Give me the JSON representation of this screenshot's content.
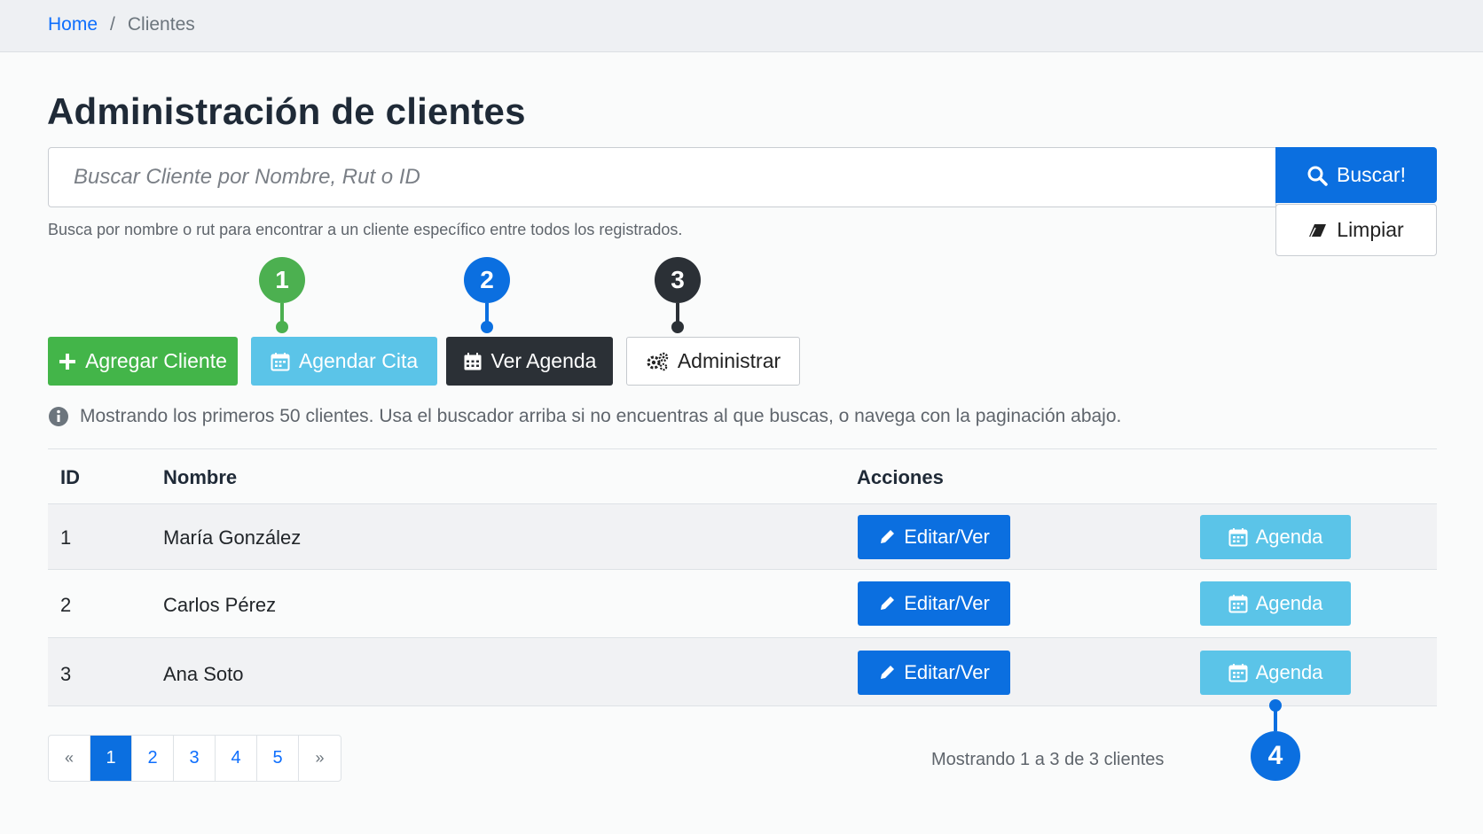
{
  "breadcrumb": {
    "home": "Home",
    "separator": "/",
    "current": "Clientes"
  },
  "page": {
    "title": "Administración de clientes"
  },
  "search": {
    "placeholder": "Buscar Cliente por Nombre, Rut o ID",
    "value": "",
    "submit_label": "Buscar!",
    "clear_label": "Limpiar",
    "help": "Busca por nombre o rut para encontrar a un cliente específico entre todos los registrados."
  },
  "actions": {
    "add_client": "Agregar Cliente",
    "schedule": "Agendar Cita",
    "view_agenda": "Ver Agenda",
    "admin": "Administrar"
  },
  "markers": [
    {
      "label": "1",
      "color": "#4cb050"
    },
    {
      "label": "2",
      "color": "#0b6fe0"
    },
    {
      "label": "3",
      "color": "#2b3036"
    },
    {
      "label": "4",
      "color": "#0b6fe0"
    }
  ],
  "info": "Mostrando los primeros 50 clientes. Usa el buscador arriba si no encuentras al que buscas,  o navega con la paginación abajo.",
  "table": {
    "headers": {
      "id": "ID",
      "name": "Nombre",
      "actions": "Acciones"
    },
    "rows": [
      {
        "id": "1",
        "name": "María González",
        "edit": "Editar/Ver",
        "agenda": "Agenda"
      },
      {
        "id": "2",
        "name": "Carlos Pérez",
        "edit": "Editar/Ver",
        "agenda": "Agenda"
      },
      {
        "id": "3",
        "name": "Ana Soto",
        "edit": "Editar/Ver",
        "agenda": "Agenda"
      }
    ]
  },
  "pagination": {
    "prev": "«",
    "pages": [
      "1",
      "2",
      "3",
      "4",
      "5"
    ],
    "active_page": "1",
    "next": "»",
    "summary": "Mostrando 1 a 3 de 3 clientes"
  },
  "colors": {
    "primary": "#0b6fe0",
    "success": "#43b549",
    "info": "#5bc4e8",
    "dark": "#2b3036"
  }
}
